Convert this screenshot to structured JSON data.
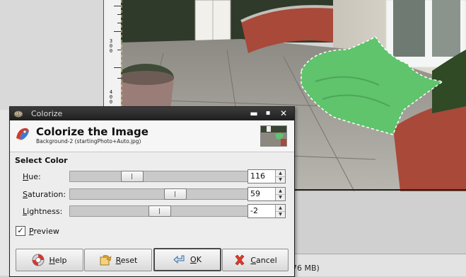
{
  "background": {
    "ruler_numbers": [
      "3",
      "0",
      "0",
      "4",
      "0",
      "0"
    ],
    "status_text": "76 MB)"
  },
  "dialog": {
    "window_title": "Colorize",
    "heading": "Colorize the Image",
    "subheading": "Background-2 (startingPhoto+Auto.jpg)",
    "section_title": "Select Color",
    "rows": [
      {
        "label": "Hue:",
        "mnemonic": "H",
        "rest": "ue:",
        "value": "116",
        "fraction": 0.32
      },
      {
        "label": "Saturation:",
        "mnemonic": "S",
        "rest": "aturation:",
        "value": "59",
        "fraction": 0.59
      },
      {
        "label": "Lightness:",
        "mnemonic": "L",
        "rest": "ightness:",
        "value": "-2",
        "fraction": 0.49
      }
    ],
    "preview": {
      "label": "Preview",
      "mnemonic": "P",
      "rest": "review",
      "checked": true
    },
    "buttons": {
      "help": {
        "label": "Help",
        "mnemonic": "H",
        "rest": "elp"
      },
      "reset": {
        "label": "Reset",
        "mnemonic": "R",
        "rest": "eset"
      },
      "ok": {
        "label": "OK",
        "mnemonic": "O",
        "rest": "K"
      },
      "cancel": {
        "label": "Cancel",
        "mnemonic": "C",
        "rest": "ancel"
      }
    }
  },
  "colors": {
    "selection_green": "#5fc46b",
    "titlebar": "#2a2a2a",
    "brick": "#a8493a"
  },
  "icons": {
    "app": "gimp-wilber-icon",
    "colorize": "colorize-icon",
    "help": "help-lifebuoy-icon",
    "reset": "reset-icon",
    "ok": "ok-arrow-icon",
    "cancel": "cancel-x-icon"
  }
}
